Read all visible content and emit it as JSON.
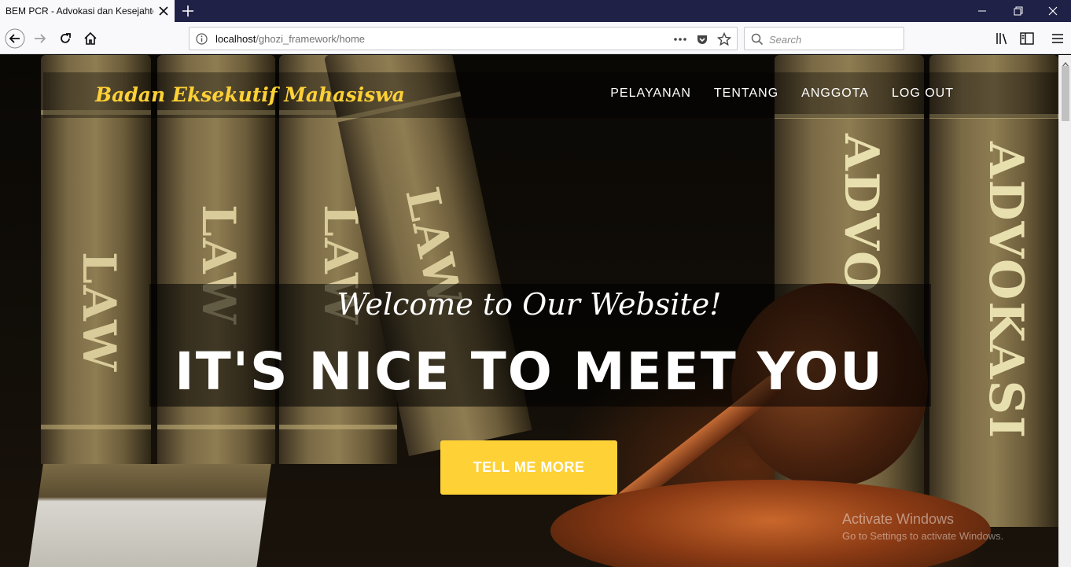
{
  "browser": {
    "tab_title": "BEM PCR - Advokasi dan Kesejahteraan",
    "url_host": "localhost",
    "url_path": "/ghozi_framework/home",
    "search_placeholder": "Search"
  },
  "site": {
    "brand": "Badan Eksekutif Mahasiswa",
    "menu": [
      "PELAYANAN",
      "TENTANG",
      "ANGGOTA",
      "LOG OUT"
    ],
    "hero_subtitle": "Welcome to Our Website!",
    "hero_title": "IT'S NICE TO MEET YOU",
    "cta_label": "TELL ME MORE"
  },
  "background_text": {
    "law": "LAW",
    "advo": "ADVO",
    "advokasi": "ADVOKASI"
  },
  "watermark": {
    "title": "Activate Windows",
    "subtitle": "Go to Settings to activate Windows."
  },
  "colors": {
    "accent": "#fed136",
    "tabstrip": "#1f2147"
  },
  "icons": [
    "close-icon",
    "plus-icon",
    "minimize-icon",
    "restore-icon",
    "back-icon",
    "forward-icon",
    "reload-icon",
    "home-icon",
    "info-icon",
    "more-icon",
    "pocket-icon",
    "star-icon",
    "search-icon",
    "library-icon",
    "sidebar-icon",
    "menu-icon"
  ]
}
